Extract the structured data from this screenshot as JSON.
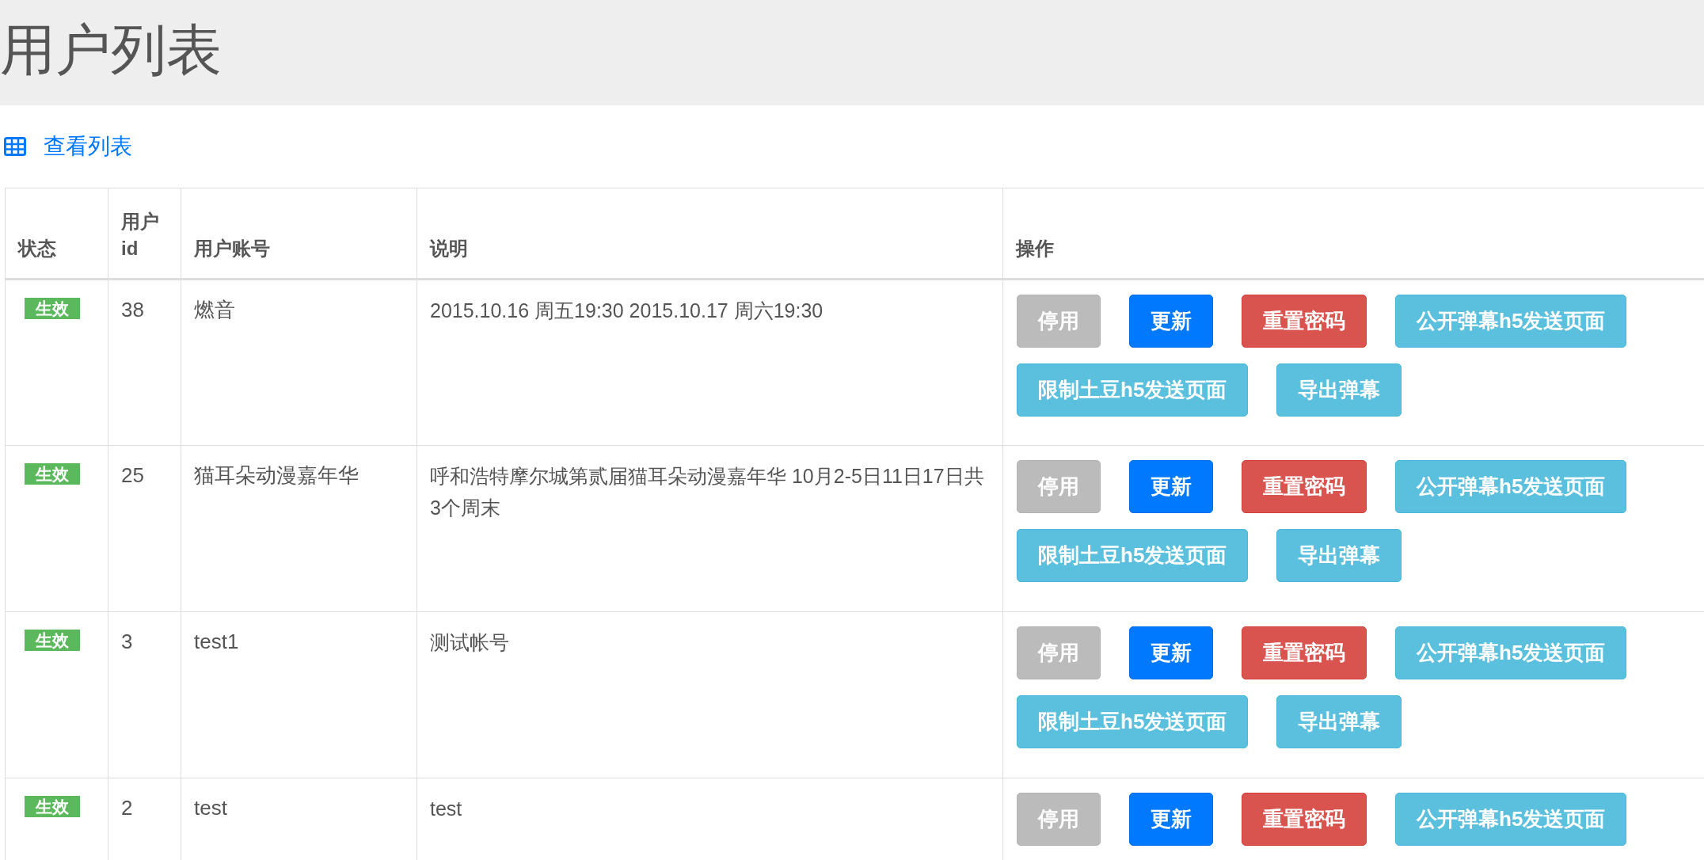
{
  "page_title": "用户列表",
  "view_link": "查看列表",
  "table": {
    "columns": [
      "状态",
      "用户\nid",
      "用户账号",
      "说明",
      "操作"
    ],
    "rows": [
      {
        "status": {
          "label": "生效",
          "kind": "success"
        },
        "id": "38",
        "account": "燃音",
        "description": "2015.10.16 周五19:30 2015.10.17 周六19:30",
        "actions": [
          {
            "label": "停用",
            "kind": "default"
          },
          {
            "label": "更新",
            "kind": "primary"
          },
          {
            "label": "重置密码",
            "kind": "danger"
          },
          {
            "label": "公开弹幕h5发送页面",
            "kind": "info"
          },
          {
            "label": "限制土豆h5发送页面",
            "kind": "info"
          },
          {
            "label": "导出弹幕",
            "kind": "info"
          }
        ]
      },
      {
        "status": {
          "label": "生效",
          "kind": "success"
        },
        "id": "25",
        "account": "猫耳朵动漫嘉年华",
        "description": "呼和浩特摩尔城第贰届猫耳朵动漫嘉年华 10月2-5日11日17日共3个周末",
        "actions": [
          {
            "label": "停用",
            "kind": "default"
          },
          {
            "label": "更新",
            "kind": "primary"
          },
          {
            "label": "重置密码",
            "kind": "danger"
          },
          {
            "label": "公开弹幕h5发送页面",
            "kind": "info"
          },
          {
            "label": "限制土豆h5发送页面",
            "kind": "info"
          },
          {
            "label": "导出弹幕",
            "kind": "info"
          }
        ]
      },
      {
        "status": {
          "label": "生效",
          "kind": "success"
        },
        "id": "3",
        "account": "test1",
        "description": "测试帐号",
        "actions": [
          {
            "label": "停用",
            "kind": "default"
          },
          {
            "label": "更新",
            "kind": "primary"
          },
          {
            "label": "重置密码",
            "kind": "danger"
          },
          {
            "label": "公开弹幕h5发送页面",
            "kind": "info"
          },
          {
            "label": "限制土豆h5发送页面",
            "kind": "info"
          },
          {
            "label": "导出弹幕",
            "kind": "info"
          }
        ]
      },
      {
        "status": {
          "label": "生效",
          "kind": "success"
        },
        "id": "2",
        "account": "test",
        "description": "test",
        "actions": [
          {
            "label": "停用",
            "kind": "default"
          },
          {
            "label": "更新",
            "kind": "primary"
          },
          {
            "label": "重置密码",
            "kind": "danger"
          },
          {
            "label": "公开弹幕h5发送页面",
            "kind": "info"
          }
        ]
      }
    ]
  }
}
